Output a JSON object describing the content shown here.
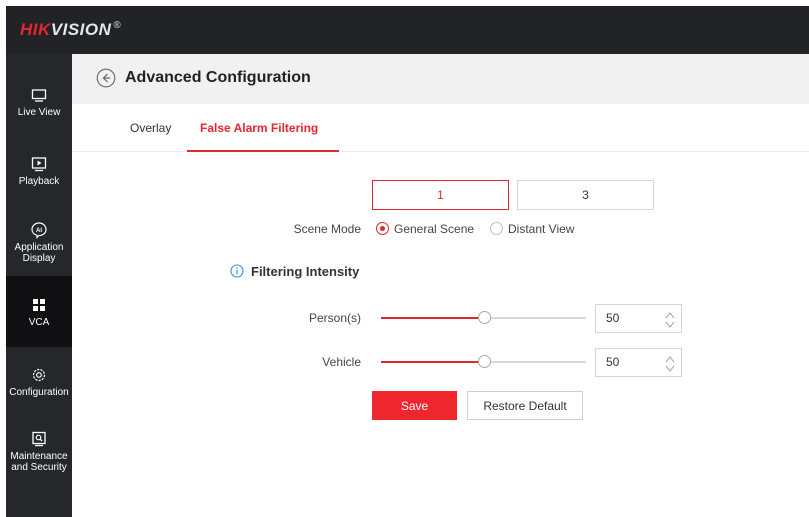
{
  "brand": {
    "name_red": "HIK",
    "name_white": "VISION",
    "reg": "®"
  },
  "sidebar": {
    "items": [
      {
        "label": "Live View",
        "icon": "monitor-icon"
      },
      {
        "label": "Playback",
        "icon": "playback-icon"
      },
      {
        "label": "Application Display",
        "label_line1": "Application",
        "label_line2": "Display",
        "icon": "ai-icon"
      },
      {
        "label": "VCA",
        "icon": "grid-icon",
        "active": true
      },
      {
        "label": "Configuration",
        "icon": "gear-icon"
      },
      {
        "label": "Maintenance and Security",
        "label_line1": "Maintenance",
        "label_line2": "and Security",
        "icon": "maintenance-icon"
      }
    ]
  },
  "header": {
    "title": "Advanced Configuration",
    "back_icon": "back-arrow-icon"
  },
  "tabs": [
    {
      "label": "Overlay",
      "active": false
    },
    {
      "label": "False Alarm Filtering",
      "active": true
    }
  ],
  "channels": [
    {
      "label": "1",
      "active": true
    },
    {
      "label": "3",
      "active": false
    }
  ],
  "scene_mode": {
    "label": "Scene Mode",
    "options": [
      {
        "label": "General Scene",
        "checked": true
      },
      {
        "label": "Distant View",
        "checked": false
      }
    ]
  },
  "filtering": {
    "title": "Filtering Intensity",
    "icon": "info-icon",
    "person": {
      "label": "Person(s)",
      "value": "50",
      "fraction": 0.5
    },
    "vehicle": {
      "label": "Vehicle",
      "value": "50",
      "fraction": 0.5
    }
  },
  "actions": {
    "save_label": "Save",
    "restore_label": "Restore Default"
  },
  "colors": {
    "accent": "#e3262f",
    "sidebar_bg": "#26272b",
    "topbar_bg": "#222326",
    "header_bg": "#f1f1f1"
  }
}
